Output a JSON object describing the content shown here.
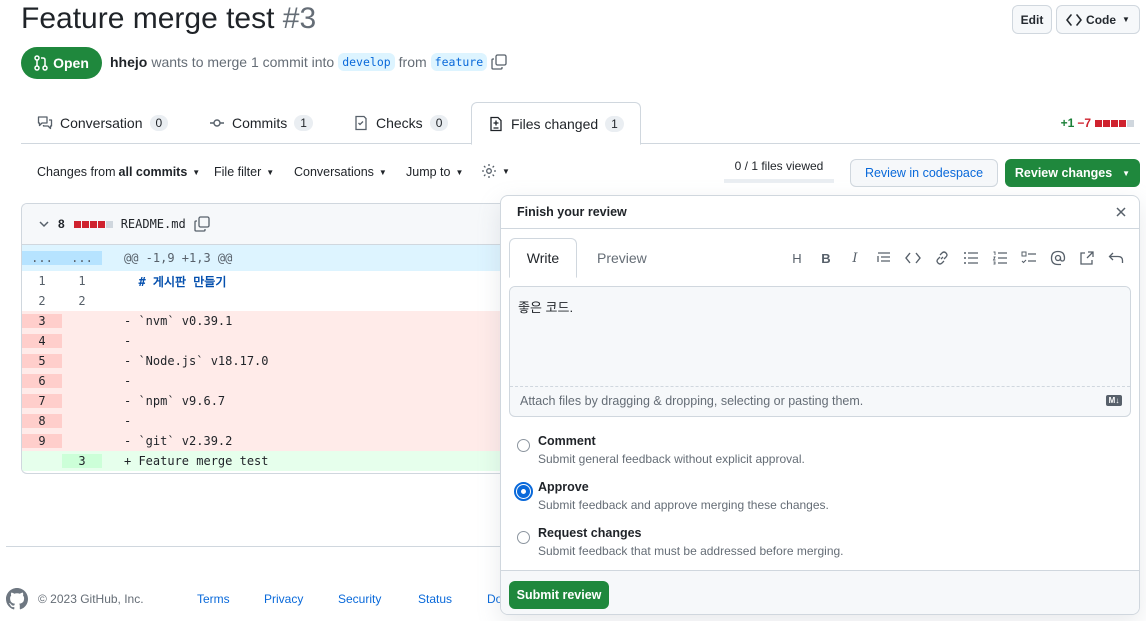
{
  "pr": {
    "title": "Feature merge test",
    "number": "#3",
    "state": "Open",
    "author": "hhejo",
    "action_text": "wants to merge 1 commit into",
    "base_branch": "develop",
    "from_text": "from",
    "head_branch": "feature"
  },
  "header_buttons": {
    "edit": "Edit",
    "code": "Code"
  },
  "tabs": [
    {
      "label": "Conversation",
      "count": "0"
    },
    {
      "label": "Commits",
      "count": "1"
    },
    {
      "label": "Checks",
      "count": "0"
    },
    {
      "label": "Files changed",
      "count": "1"
    }
  ],
  "diffstat": {
    "additions": "+1",
    "deletions": "−7"
  },
  "toolbar": {
    "changes_prefix": "Changes from",
    "changes_value": "all commits",
    "file_filter": "File filter",
    "conversations": "Conversations",
    "jump_to": "Jump to",
    "files_viewed": "0 / 1 files viewed",
    "review_codespace": "Review in codespace",
    "review_changes": "Review changes"
  },
  "file": {
    "change_count": "8",
    "name": "README.md",
    "hunk_left": "...",
    "hunk_right": "...",
    "hunk_header": "@@ -1,9 +1,3 @@",
    "lines": [
      {
        "type": "ctx",
        "left": "1",
        "right": "1",
        "text": "  # 게시판 만들기"
      },
      {
        "type": "ctx",
        "left": "2",
        "right": "2",
        "text": ""
      },
      {
        "type": "del",
        "left": "3",
        "right": "",
        "text": "- `nvm` v0.39.1"
      },
      {
        "type": "del",
        "left": "4",
        "right": "",
        "text": "-"
      },
      {
        "type": "del",
        "left": "5",
        "right": "",
        "text": "- `Node.js` v18.17.0"
      },
      {
        "type": "del",
        "left": "6",
        "right": "",
        "text": "-"
      },
      {
        "type": "del",
        "left": "7",
        "right": "",
        "text": "- `npm` v9.6.7"
      },
      {
        "type": "del",
        "left": "8",
        "right": "",
        "text": "-"
      },
      {
        "type": "del",
        "left": "9",
        "right": "",
        "text": "- `git` v2.39.2"
      },
      {
        "type": "add",
        "left": "",
        "right": "3",
        "text": "+ Feature merge test"
      }
    ]
  },
  "review": {
    "title": "Finish your review",
    "write_tab": "Write",
    "preview_tab": "Preview",
    "comment_text": "좋은 코드.",
    "attach_hint": "Attach files by dragging & dropping, selecting or pasting them.",
    "options": [
      {
        "label": "Comment",
        "desc": "Submit general feedback without explicit approval.",
        "checked": false
      },
      {
        "label": "Approve",
        "desc": "Submit feedback and approve merging these changes.",
        "checked": true
      },
      {
        "label": "Request changes",
        "desc": "Submit feedback that must be addressed before merging.",
        "checked": false
      }
    ],
    "submit": "Submit review"
  },
  "footer": {
    "copyright": "© 2023 GitHub, Inc.",
    "links": [
      "Terms",
      "Privacy",
      "Security",
      "Status",
      "Do"
    ]
  },
  "colors": {
    "accent_green": "#1f883d",
    "link_blue": "#0969da",
    "deletion_red": "#cf222e"
  }
}
